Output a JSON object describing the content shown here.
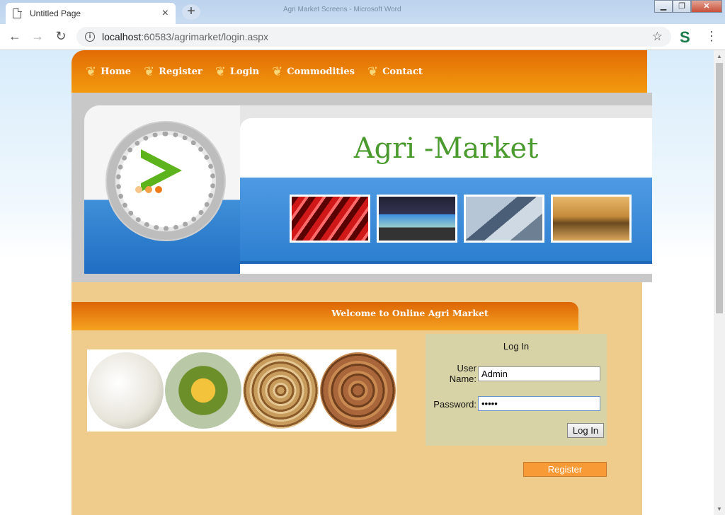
{
  "browser": {
    "tab_title": "Untitled Page",
    "tab_close": "×",
    "new_tab": "+",
    "window_title": "Agri Market Screens - Microsoft Word",
    "url_host": "localhost",
    "url_rest": ":60583/agrimarket/login.aspx",
    "icons": [
      "back-icon",
      "forward-icon",
      "reload-icon",
      "info-icon",
      "star-icon",
      "extension-icon",
      "menu-icon"
    ]
  },
  "nav": {
    "items": [
      {
        "label": "Home"
      },
      {
        "label": "Register"
      },
      {
        "label": "Login"
      },
      {
        "label": "Commodities"
      },
      {
        "label": "Contact"
      }
    ]
  },
  "banner": {
    "title": "Agri -Market"
  },
  "welcome": {
    "text": "Welcome to Online Agri Market"
  },
  "login": {
    "title": "Log In",
    "username_label": "User Name:",
    "username_value": "Admin",
    "password_label": "Password:",
    "password_value": "•••••",
    "login_button": "Log In",
    "register_button": "Register"
  },
  "colors": {
    "nav_orange": "#f39a0e",
    "title_green": "#4a9a2e",
    "content_bg": "#f0cc8c",
    "login_bg": "#d8d3a6",
    "register_button": "#f89a35"
  }
}
